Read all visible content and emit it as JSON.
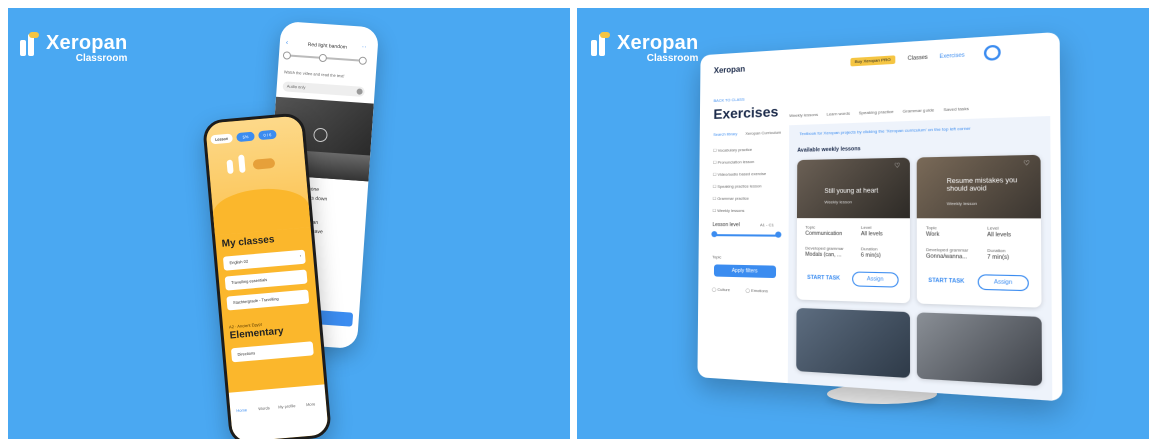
{
  "brand": {
    "name": "Xeropan",
    "sub": "Classroom"
  },
  "phone_back": {
    "lesson_title": "Red light bandom",
    "prompt": "Watch the video and read the text!",
    "audio_label": "Audio only",
    "text_lines": [
      "ty against someone",
      "the device counts down",
      "light.",
      "creative idea. Urban",
      "g has potential to save",
      "tiveness from"
    ],
    "continue_label": "Continue"
  },
  "phone_front": {
    "pills": [
      "Lesson",
      "5%",
      "0 / 6"
    ],
    "section_title": "My classes",
    "classes": [
      "English 02",
      "Travelling essentials",
      "Stachtergrade - Travelling"
    ],
    "level_caption": "A2 · Ancient Egypt",
    "level_title": "Elementary",
    "lesson_item": "Directions",
    "nav": [
      "Home",
      "Words",
      "My profile",
      "More"
    ]
  },
  "desktop": {
    "topbar": {
      "pro_badge": "Buy Xeropan PRO",
      "nav": [
        "Classes",
        "Exercises"
      ]
    },
    "back_link": "BACK TO CLASS",
    "page_title": "Exercises",
    "tabs": [
      "Weekly lessons",
      "Learn words",
      "Speaking practice",
      "Grammar guide",
      "Saved tasks"
    ],
    "sidebar_tabs": [
      "Search library",
      "Xeropan Curriculum"
    ],
    "filters": [
      "Vocabulary practice",
      "Pronunciation lesson",
      "Video/audio based exercise",
      "Speaking practice lesson",
      "Grammar practice",
      "Weekly lessons"
    ],
    "level_label": "Lesson level",
    "level_range": "A1 - C1",
    "topic_label": "Topic",
    "apply_label": "Apply filters",
    "checkbox_tags": [
      "Culture",
      "Emotions"
    ],
    "info_banner": "Textbook for Xeropan projects by clicking the 'Xeropan curriculum' on the top left corner",
    "section_title": "Available weekly lessons",
    "cards": [
      {
        "banner": "Still young at heart",
        "banner_sub": "Weekly lesson",
        "topic_label": "Topic",
        "topic": "Communication",
        "level_label": "Level",
        "level": "All levels",
        "grammar_label": "Developed grammar",
        "grammar": "Modals (can, ...",
        "duration_label": "Duration",
        "duration": "6 min(s)",
        "start_label": "START TASK",
        "assign_label": "Assign"
      },
      {
        "banner": "Resume mistakes you should avoid",
        "banner_sub": "Weekly lesson",
        "topic_label": "Topic",
        "topic": "Work",
        "level_label": "Level",
        "level": "All levels",
        "grammar_label": "Developed grammar",
        "grammar": "Gonna/wanna...",
        "duration_label": "Duration",
        "duration": "7 min(s)",
        "start_label": "START TASK",
        "assign_label": "Assign"
      }
    ]
  },
  "colors": {
    "background": "#4aa8f2",
    "accent": "#3b8cf0",
    "phone_yellow": "#fbb72c",
    "pro_badge": "#f5c542"
  }
}
